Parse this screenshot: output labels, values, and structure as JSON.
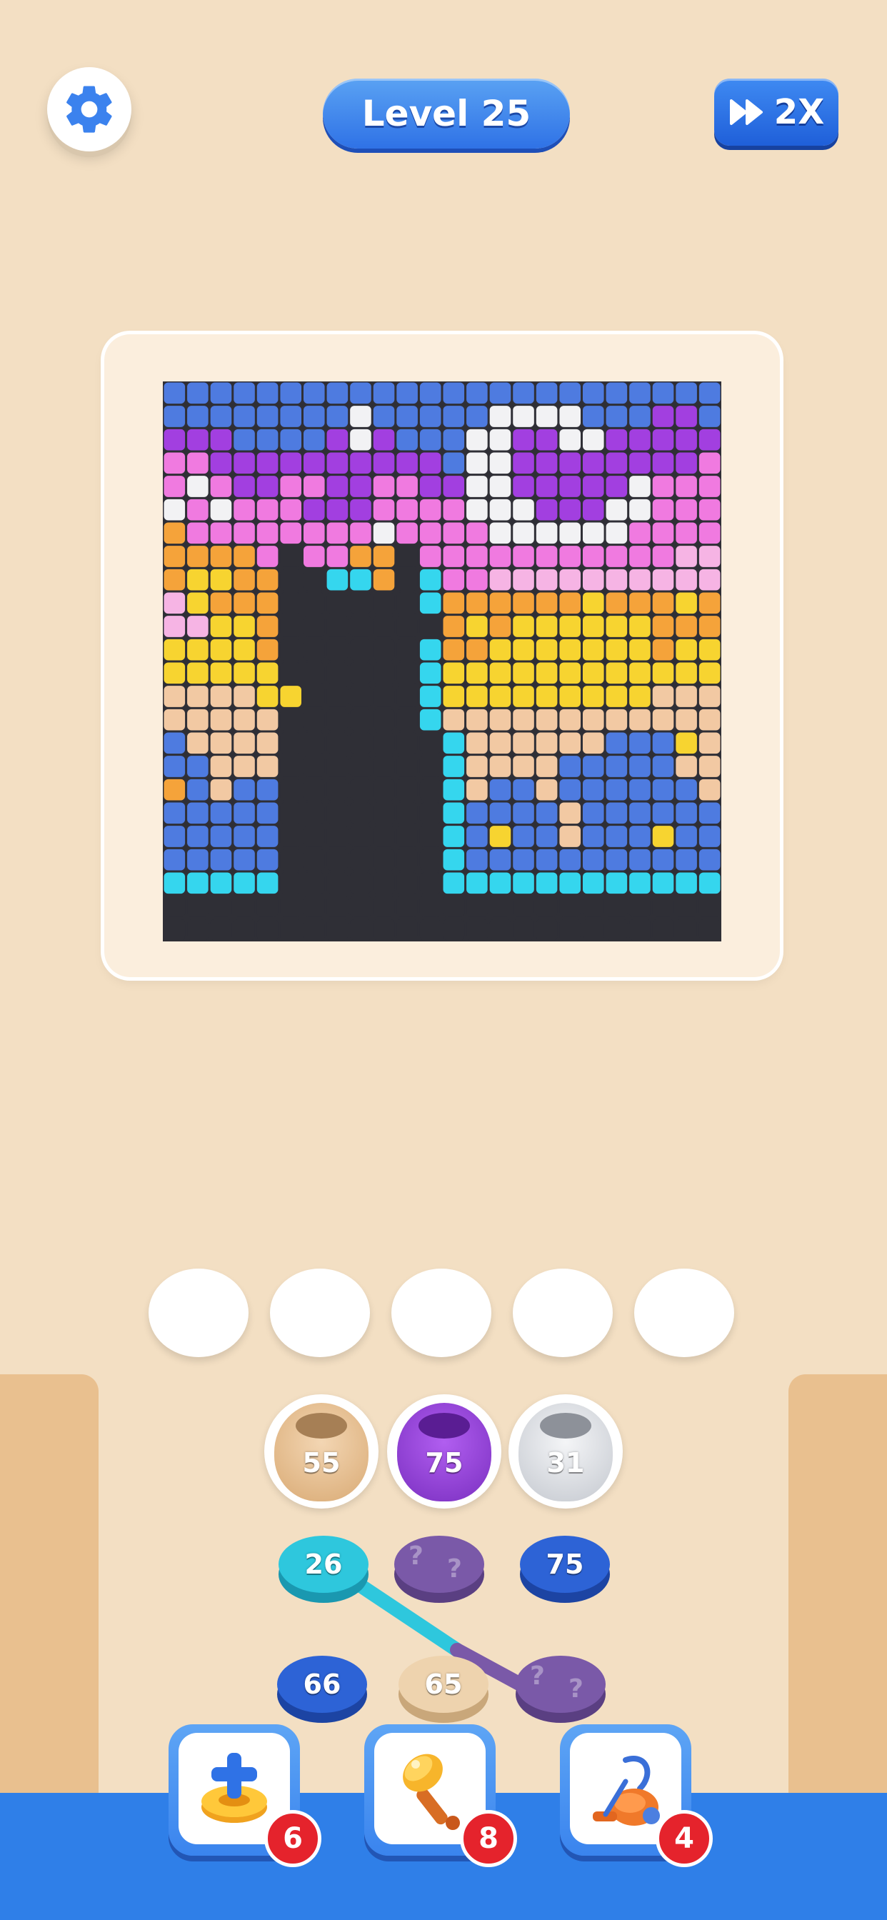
{
  "header": {
    "level_label": "Level 25",
    "speed_label": "2X"
  },
  "icons": {
    "settings": "gear-icon",
    "speed": "fast-forward-icon",
    "add_slot": "plus-ring-icon",
    "hammer": "hammer-icon",
    "vacuum": "vacuum-icon"
  },
  "colors": {
    "background": "#f3dfc3",
    "accent_blue": "#2f72e6",
    "badge_red": "#e5232c"
  },
  "slots": {
    "count": 5
  },
  "spools": [
    {
      "value": "55",
      "color": "#e6c196"
    },
    {
      "value": "75",
      "color": "#8e3fd1"
    },
    {
      "value": "31",
      "color": "#dadde2"
    }
  ],
  "coins": [
    {
      "value": "26",
      "color": "#2ec7dd",
      "hidden": false
    },
    {
      "value": "",
      "color": "#7a59a8",
      "hidden": true
    },
    {
      "value": "75",
      "color": "#2d63d6",
      "hidden": false
    },
    {
      "value": "66",
      "color": "#2d63d6",
      "hidden": false
    },
    {
      "value": "65",
      "color": "#eed3ae",
      "hidden": false
    },
    {
      "value": "",
      "color": "#7a59a8",
      "hidden": true
    }
  ],
  "boosters": [
    {
      "name": "add-slot",
      "count": "6"
    },
    {
      "name": "hammer",
      "count": "8"
    },
    {
      "name": "vacuum",
      "count": "4"
    }
  ],
  "puzzle": {
    "grid_size": 24,
    "palette": {
      "B": "#4e7be0",
      "P": "#a23fe0",
      "K": "#f07ae0",
      "W": "#f2f2f4",
      "O": "#f5a33a",
      "Y": "#f7d430",
      "T": "#f2c9a3",
      "C": "#35d6ee",
      "D": "#2f2f36",
      "L": "#f6b4e4"
    },
    "rows": [
      "BBBBBBBBBBBBBBBBBBBBBBBB",
      "BBBBBBBBWBBBBBWWWWBBBPPB",
      "PPPBBBBPWPBBBWWPPWWPPPPP",
      "KKPPPPPPPPPPBWWPPPPPPPPK",
      "KWKPPKKPPKKPPWWPPPPPWKKK",
      "WKWKKKPPPKKKKWWWPPPWWKKK",
      "OKKKKKKKKWKKKKWWWWWWKKKK",
      "OOOOKDKKOODKKKKKKKKKKKLL",
      "OYYOODDCCODCKKLLLLLLLLLL",
      "LYOOODDDDDDCOOOOOOYOOOYO",
      "LLYYODDDDDDDOYOYYYYYYOOO",
      "YYYYODDDDDDCOOYYYYYYYOYY",
      "YYYYYDDDDDDCYYYYYYYYYYYY",
      "TTTTYYDDDDDCYYYYYYYYYTTT",
      "TTTTTDDDDDDCTTTTTTTTTTTT",
      "BTTTTDDDDDDDCTTTTTTBBBYTT",
      "BBTTTDDDDDDDCTTTTBBBBBTT",
      "OBTBBDDDDDDDCTBBTBBBBBBT",
      "BBBBBDDDDDDDCBBBBTBBBBBB",
      "BBBBBDDDDDDDCBYBBTBBBYBB",
      "BBBBBDDDDDDDCBBBBBBBBBBB",
      "CCCCCDDDDDDDCCCCCCCCCCCC",
      "DDDDDDDDDDDDDDDDDDDDDDDD",
      "DDDDDDDDDDDDDDDDDDDDDDDD"
    ]
  }
}
